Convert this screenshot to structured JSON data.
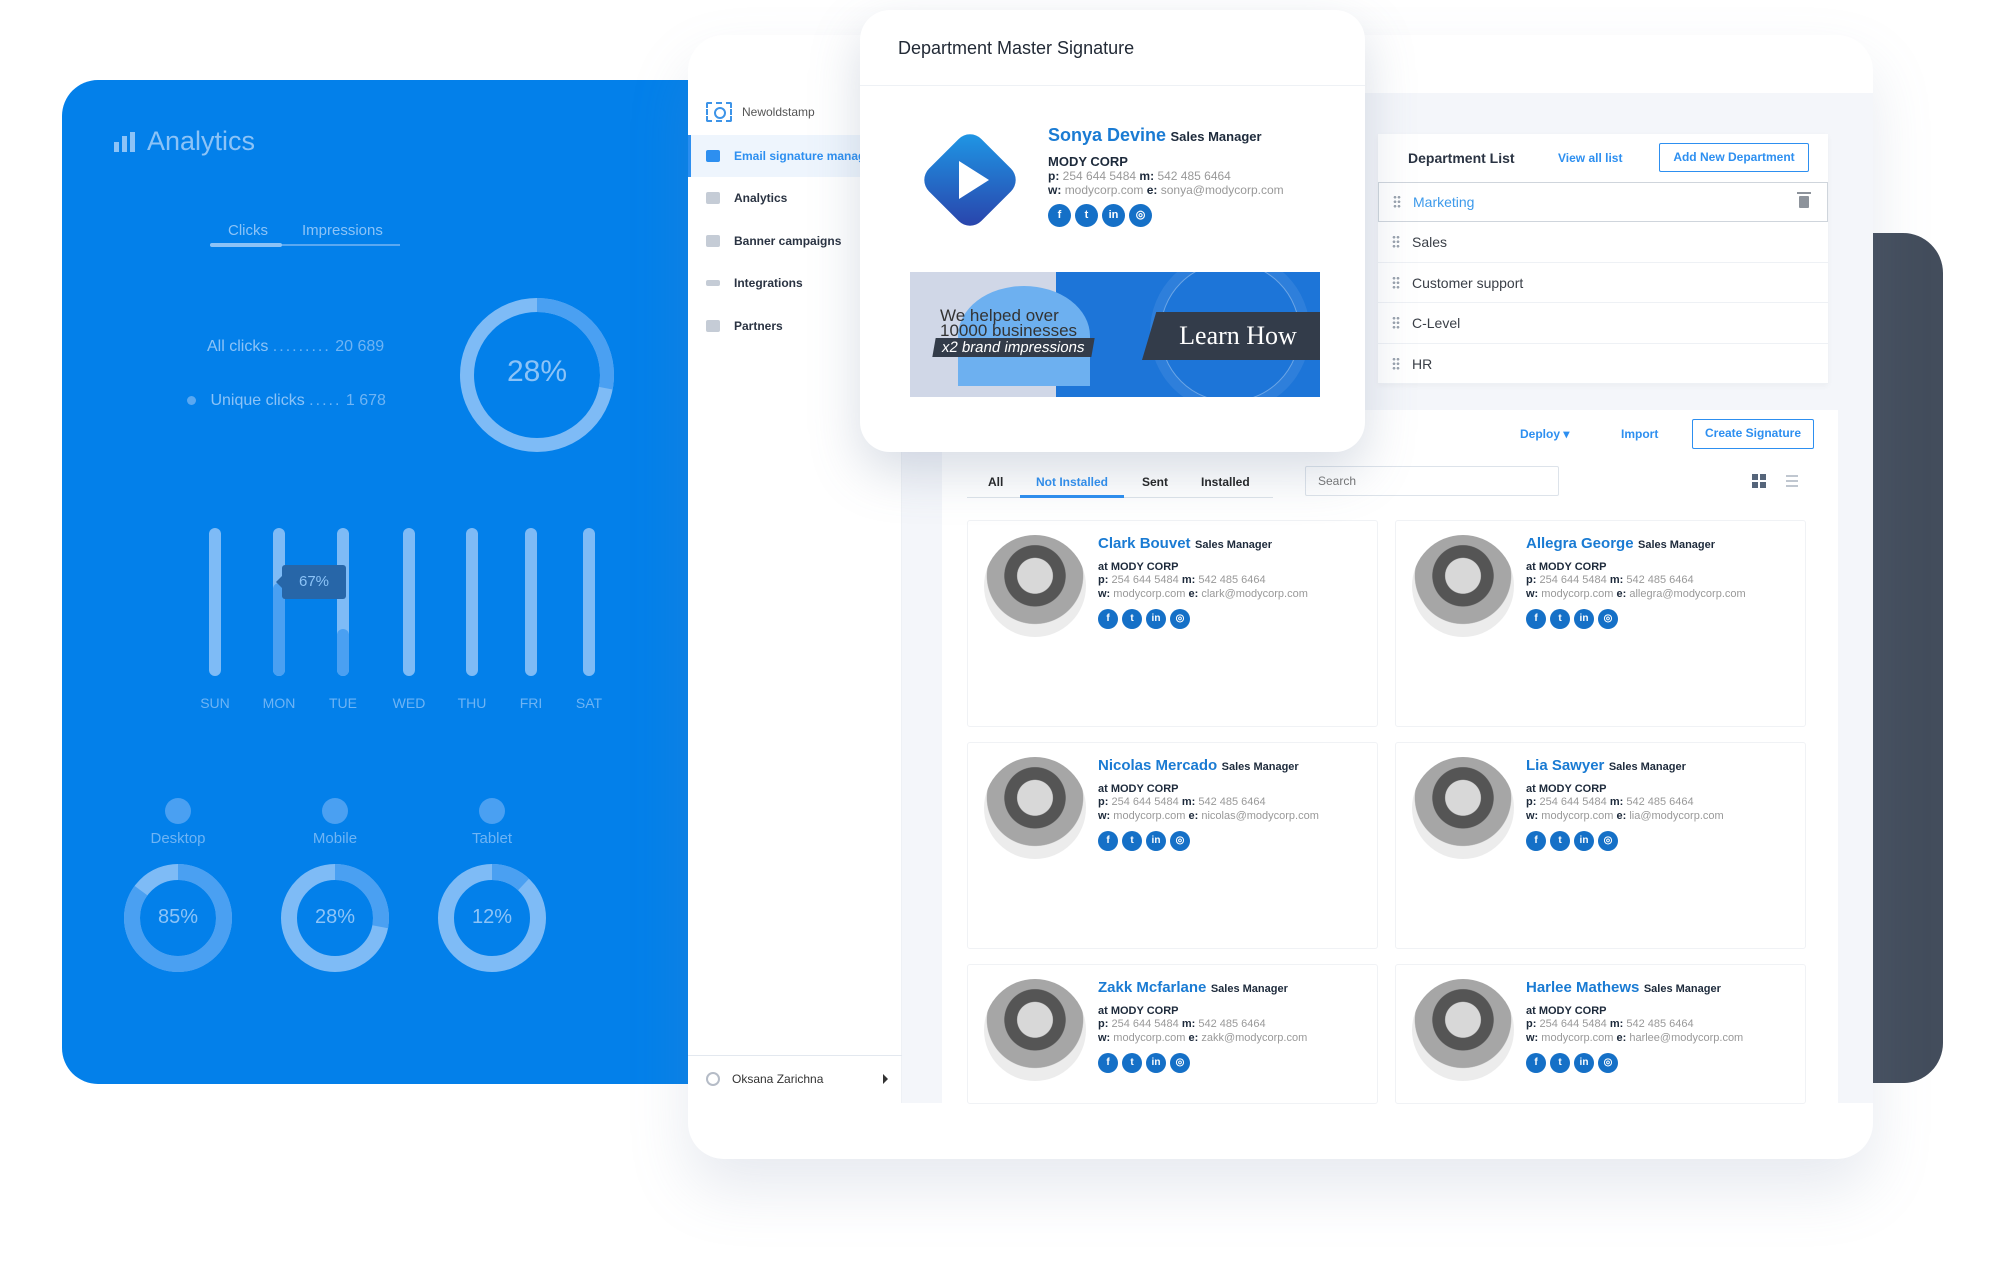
{
  "analytics": {
    "title": "Analytics",
    "tabs": [
      "Clicks",
      "Impressions"
    ],
    "active_tab": "Clicks",
    "all_clicks_label": "All clicks",
    "all_clicks_dots": ".........",
    "all_clicks_value": "20 689",
    "unique_clicks_label": "Unique clicks",
    "unique_clicks_dots": ".....",
    "unique_clicks_value": "1 678",
    "main_ring": {
      "label": "28%",
      "value": 28
    },
    "days": [
      "SUN",
      "MON",
      "TUE",
      "WED",
      "THU",
      "FRI",
      "SAT"
    ],
    "day_values": [
      0,
      63,
      32,
      0,
      0,
      0,
      0
    ],
    "tooltip": "67%",
    "devices": [
      {
        "name": "Desktop",
        "icon": "desktop-icon",
        "label": "85%",
        "value": 85
      },
      {
        "name": "Mobile",
        "icon": "mobile-icon",
        "label": "28%",
        "value": 28
      },
      {
        "name": "Tablet",
        "icon": "tablet-icon",
        "label": "12%",
        "value": 12
      }
    ]
  },
  "sidebar": {
    "brand": "Newoldstamp",
    "items": [
      {
        "label": "Email signature manage",
        "icon": "id-card-icon",
        "active": true
      },
      {
        "label": "Analytics",
        "icon": "bar-chart-icon"
      },
      {
        "label": "Banner campaigns",
        "icon": "calendar-icon"
      },
      {
        "label": "Integrations",
        "icon": "arrows-icon"
      },
      {
        "label": "Partners",
        "icon": "grid-plus-icon"
      }
    ],
    "user": "Oksana Zarichna"
  },
  "popup": {
    "title": "Department Master Signature",
    "name": "Sonya Devine",
    "role": "Sales Manager",
    "company": "MODY CORP",
    "phone_label": "p:",
    "phone": "254 644 5484",
    "mobile_label": "m:",
    "mobile": "542 485 6464",
    "web_label": "w:",
    "web": "modycorp.com",
    "email_label": "e:",
    "email": "sonya@modycorp.com",
    "banner": {
      "line1": "We helped over",
      "line2": "10000 businesses",
      "line3": "x2 brand impressions",
      "cta": "Learn How"
    }
  },
  "social": [
    "f",
    "t",
    "in",
    "ig"
  ],
  "dept": {
    "title": "Department List",
    "view_all": "View all list",
    "add": "Add New Department",
    "items": [
      "Marketing",
      "Sales",
      "Customer support",
      "C-Level",
      "HR"
    ],
    "selected": "Marketing"
  },
  "toolbar": {
    "deploy": "Deploy ▾",
    "import": "Import",
    "create": "Create Signature",
    "tabs": [
      "All",
      "Not Installed",
      "Sent",
      "Installed"
    ],
    "active_tab": "Not Installed",
    "search_placeholder": "Search"
  },
  "signatures": [
    {
      "name": "Clark Bouvet",
      "role": "Sales Manager",
      "company": "at MODY CORP",
      "phone": "254 644 5484",
      "mobile": "542 485 6464",
      "web": "modycorp.com",
      "email": "clark@modycorp.com"
    },
    {
      "name": "Allegra George",
      "role": "Sales Manager",
      "company": "at MODY CORP",
      "phone": "254 644 5484",
      "mobile": "542 485 6464",
      "web": "modycorp.com",
      "email": "allegra@modycorp.com"
    },
    {
      "name": "Nicolas Mercado",
      "role": "Sales Manager",
      "company": "at MODY CORP",
      "phone": "254 644 5484",
      "mobile": "542 485 6464",
      "web": "modycorp.com",
      "email": "nicolas@modycorp.com"
    },
    {
      "name": "Lia Sawyer",
      "role": "Sales Manager",
      "company": "at MODY CORP",
      "phone": "254 644 5484",
      "mobile": "542 485 6464",
      "web": "modycorp.com",
      "email": "lia@modycorp.com"
    },
    {
      "name": "Zakk Mcfarlane",
      "role": "Sales Manager",
      "company": "at MODY CORP",
      "phone": "254 644 5484",
      "mobile": "542 485 6464",
      "web": "modycorp.com",
      "email": "zakk@modycorp.com"
    },
    {
      "name": "Harlee Mathews",
      "role": "Sales Manager",
      "company": "at MODY CORP",
      "phone": "254 644 5484",
      "mobile": "542 485 6464",
      "web": "modycorp.com",
      "email": "harlee@modycorp.com"
    }
  ],
  "labels": {
    "p": "p:",
    "m": "m:",
    "w": "w:",
    "e": "e:"
  },
  "colors": {
    "analytics_bg": "#0380ea",
    "accent": "#2d8ff0",
    "name_blue": "#1a7bd3",
    "dark_panel": "#434d5c"
  }
}
